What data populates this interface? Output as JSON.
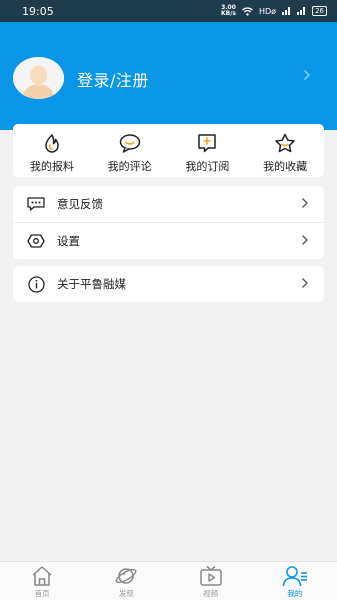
{
  "status_bar": {
    "time": "19:05",
    "net_speed_top": "3.00",
    "net_speed_bottom": "KB/s",
    "network": "HDø",
    "battery": "26"
  },
  "header": {
    "login_label": "登录/注册"
  },
  "quick_actions": [
    {
      "label": "我的报料",
      "icon": "fire-icon"
    },
    {
      "label": "我的评论",
      "icon": "comment-icon"
    },
    {
      "label": "我的订阅",
      "icon": "subscribe-icon"
    },
    {
      "label": "我的收藏",
      "icon": "star-icon"
    }
  ],
  "menu": [
    {
      "label": "意见反馈",
      "icon": "feedback-icon"
    },
    {
      "label": "设置",
      "icon": "settings-icon"
    }
  ],
  "about": {
    "label": "关于平鲁融媒",
    "icon": "info-icon"
  },
  "tabbar": [
    {
      "label": "首页",
      "icon": "home-icon"
    },
    {
      "label": "发现",
      "icon": "planet-icon"
    },
    {
      "label": "视频",
      "icon": "tv-icon"
    },
    {
      "label": "我的",
      "icon": "user-icon",
      "active": true
    }
  ],
  "colors": {
    "primary": "#0996e6",
    "status_bar": "#1f3c4d",
    "background": "#f2f2f2",
    "accent_orange": "#f5a623"
  }
}
